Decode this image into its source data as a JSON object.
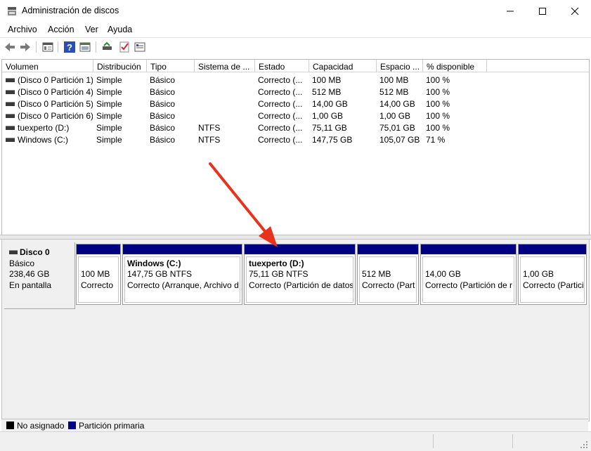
{
  "window": {
    "title": "Administración de discos"
  },
  "menu": [
    "Archivo",
    "Acción",
    "Ver",
    "Ayuda"
  ],
  "toolbar": [
    "back-icon",
    "forward-icon",
    "properties-icon",
    "help-icon",
    "show-pane-icon",
    "connect-disk-icon",
    "check-icon",
    "settings-icon"
  ],
  "volume_table": {
    "columns": [
      "Volumen",
      "Distribución",
      "Tipo",
      "Sistema de ...",
      "Estado",
      "Capacidad",
      "Espacio ...",
      "% disponible"
    ],
    "rows": [
      [
        "(Disco 0 Partición 1)",
        "Simple",
        "Básico",
        "",
        "Correcto (...",
        "100 MB",
        "100 MB",
        "100 %"
      ],
      [
        "(Disco 0 Partición 4)",
        "Simple",
        "Básico",
        "",
        "Correcto (...",
        "512 MB",
        "512 MB",
        "100 %"
      ],
      [
        "(Disco 0 Partición 5)",
        "Simple",
        "Básico",
        "",
        "Correcto (...",
        "14,00 GB",
        "14,00 GB",
        "100 %"
      ],
      [
        "(Disco 0 Partición 6)",
        "Simple",
        "Básico",
        "",
        "Correcto (...",
        "1,00 GB",
        "1,00 GB",
        "100 %"
      ],
      [
        "tuexperto (D:)",
        "Simple",
        "Básico",
        "NTFS",
        "Correcto (...",
        "75,11 GB",
        "75,01 GB",
        "100 %"
      ],
      [
        "Windows (C:)",
        "Simple",
        "Básico",
        "NTFS",
        "Correcto (...",
        "147,75 GB",
        "105,07 GB",
        "71 %"
      ]
    ]
  },
  "disk": {
    "name": "Disco 0",
    "type": "Básico",
    "size": "238,46 GB",
    "status": "En pantalla",
    "partitions": [
      {
        "title": "",
        "size": "100 MB",
        "status": "Correcto"
      },
      {
        "title": "Windows  (C:)",
        "size": "147,75 GB NTFS",
        "status": "Correcto (Arranque, Archivo d"
      },
      {
        "title": "tuexperto  (D:)",
        "size": "75,11 GB NTFS",
        "status": "Correcto (Partición de datos"
      },
      {
        "title": "",
        "size": "512 MB",
        "status": "Correcto (Part"
      },
      {
        "title": "",
        "size": "14,00 GB",
        "status": "Correcto (Partición de r"
      },
      {
        "title": "",
        "size": "1,00 GB",
        "status": "Correcto (Partici"
      }
    ]
  },
  "legend": [
    {
      "label": "No asignado",
      "color": "#000000"
    },
    {
      "label": "Partición primaria",
      "color": "#000080"
    }
  ],
  "colors": {
    "partition_bar": "#000080",
    "arrow": "#e8321c"
  }
}
